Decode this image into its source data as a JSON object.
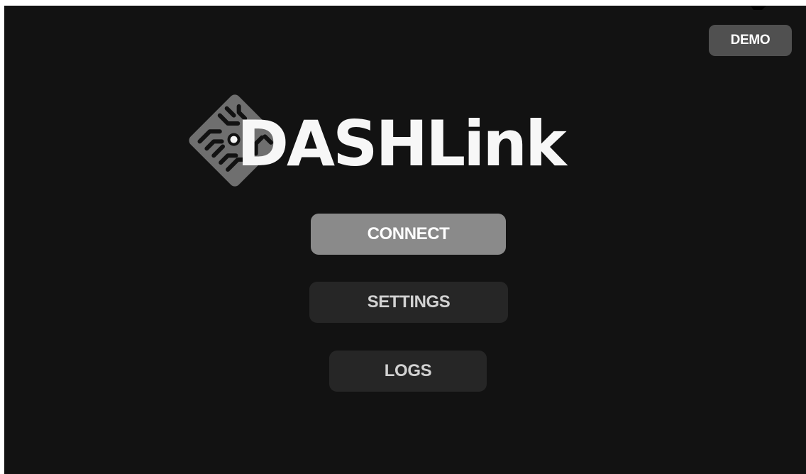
{
  "app": {
    "logo_text": "DASHLink",
    "logo_icon": "circuit-chip-icon"
  },
  "header": {
    "demo_label": "DEMO"
  },
  "menu": {
    "connect_label": "CONNECT",
    "settings_label": "SETTINGS",
    "logs_label": "LOGS"
  },
  "colors": {
    "background": "#121212",
    "primary_button": "#8a8a8a",
    "secondary_button": "#262626",
    "demo_button": "#505050",
    "logo_text": "#f7f7f7",
    "logo_icon": "#6f6f6f"
  }
}
